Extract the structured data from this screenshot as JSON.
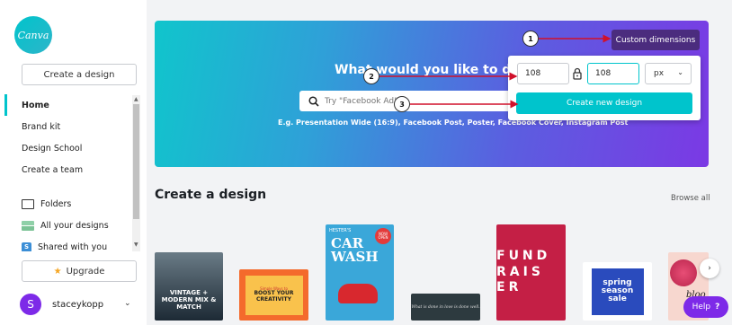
{
  "sidebar": {
    "logo_text": "Canva",
    "create_design_label": "Create a design",
    "nav_items": [
      {
        "label": "Home",
        "active": true
      },
      {
        "label": "Brand kit"
      },
      {
        "label": "Design School"
      },
      {
        "label": "Create a team"
      },
      {
        "label": "Folders",
        "icon": "folder-icon"
      },
      {
        "label": "All your designs",
        "icon": "designs-icon"
      },
      {
        "label": "Shared with you",
        "icon": "shared-icon",
        "icon_text": "S"
      }
    ],
    "upgrade_label": "Upgrade",
    "user": {
      "initial": "S",
      "name": "staceykopp"
    }
  },
  "hero": {
    "title": "What would you like to design?",
    "search_placeholder": "Try \"Facebook Ad\"",
    "examples": "E.g. Presentation Wide (16:9), Facebook Post, Poster, Facebook Cover, Instagram Post"
  },
  "custom_dimensions": {
    "button_label": "Custom dimensions",
    "width_value": "108",
    "height_value": "108",
    "unit": "px",
    "create_label": "Create new design"
  },
  "annotations": [
    "1",
    "2",
    "3"
  ],
  "section": {
    "title": "Create a design",
    "browse_all": "Browse all"
  },
  "thumbnails": {
    "t1": "VINTAGE + MODERN MIX & MATCH",
    "t2_small": "Simple Ways to",
    "t2_big": "BOOST YOUR CREATIVITY",
    "t3_top": "HESTER'S",
    "t3_title": "CAR WASH",
    "t3_badge": "NOW OPEN",
    "t4": "What is done in love is done well.",
    "t5": "FUND RAIS ER",
    "t6": "spring season sale",
    "t7": "bloo"
  },
  "help_label": "Help",
  "colors": {
    "accent": "#00c4cc",
    "purple": "#7d2ae8",
    "custom_btn": "#4b2c7e"
  }
}
